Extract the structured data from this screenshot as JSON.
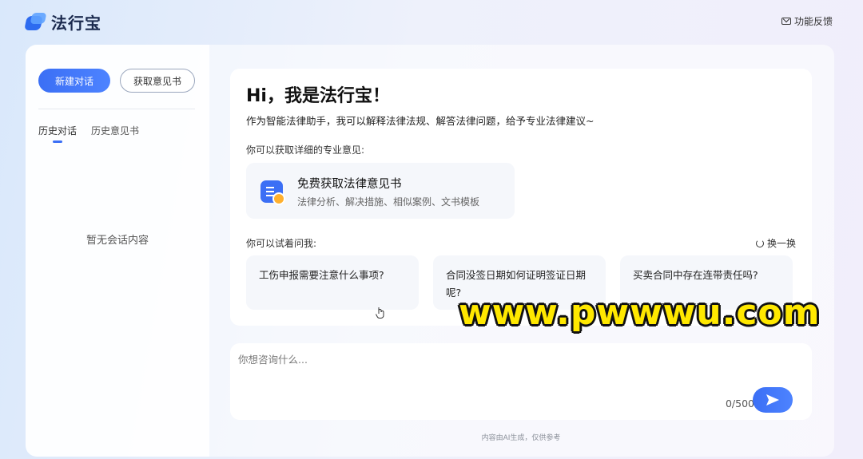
{
  "app": {
    "name": "法行宝"
  },
  "header": {
    "feedback_label": "功能反馈"
  },
  "sidebar": {
    "new_chat_label": "新建对话",
    "get_opinion_label": "获取意见书",
    "tabs": [
      {
        "label": "历史对话",
        "active": true
      },
      {
        "label": "历史意见书",
        "active": false
      }
    ],
    "empty_text": "暂无会话内容"
  },
  "welcome": {
    "title": "Hi，我是法行宝！",
    "intro": "作为智能法律助手，我可以解释法律法规、解答法律问题，给予专业法律建议~",
    "opinion_prompt": "你可以获取详细的专业意见:",
    "free_card": {
      "title": "免费获取法律意见书",
      "desc": "法律分析、解决措施、相似案例、文书模板"
    },
    "try_prompt": "你可以试着问我:",
    "refresh_label": "换一换",
    "questions": [
      "工伤申报需要注意什么事项?",
      "合同没签日期如何证明签证日期呢?",
      "买卖合同中存在连带责任吗?"
    ]
  },
  "input": {
    "placeholder": "你想咨询什么...",
    "counter": "0/500"
  },
  "footer": {
    "text": "内容由AI生成，仅供参考"
  },
  "watermark": {
    "text": "www.pwwwu.com"
  },
  "colors": {
    "accent": "#3b6ff5",
    "watermark": "#ffe800"
  }
}
